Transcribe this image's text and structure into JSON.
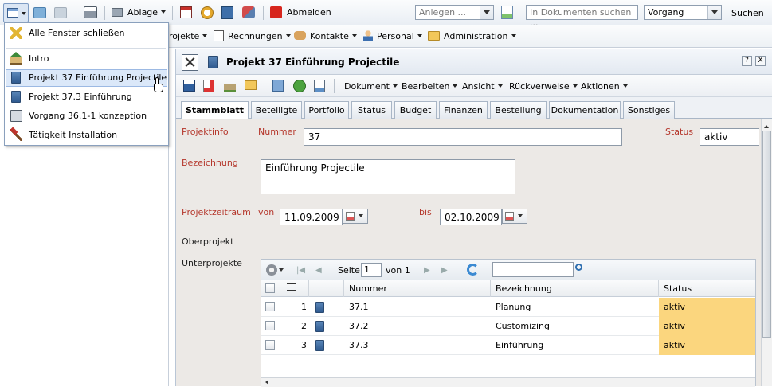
{
  "topbar": {
    "ablage_label": "Ablage",
    "abmelden_label": "Abmelden",
    "anlegen_placeholder": "Anlegen ...",
    "search_placeholder": "In Dokumenten suchen ...",
    "search_scope_value": "Vorgang",
    "suchen_label": "Suchen"
  },
  "menubar": {
    "items": [
      "rojekte",
      "Rechnungen",
      "Kontakte",
      "Personal",
      "Administration"
    ]
  },
  "window_menu": {
    "items": [
      {
        "label": "Alle Fenster schließen",
        "icon": "close-all-icon"
      },
      {
        "label": "Intro",
        "icon": "home-icon"
      },
      {
        "label": "Projekt 37 Einführung Projectile",
        "icon": "project-book-icon"
      },
      {
        "label": "Projekt 37.3 Einführung",
        "icon": "project-book-icon"
      },
      {
        "label": "Vorgang 36.1-1 konzeption",
        "icon": "process-icon"
      },
      {
        "label": "Tätigkeit Installation",
        "icon": "hammer-icon"
      }
    ]
  },
  "panel": {
    "title": "Projekt 37 Einführung Projectile",
    "help": "?",
    "close": "X",
    "toolbar_menus": [
      "Dokument",
      "Bearbeiten",
      "Ansicht",
      "Rückverweise",
      "Aktionen"
    ],
    "tabs": [
      "Stammblatt",
      "Beteiligte",
      "Portfolio",
      "Status",
      "Budget",
      "Finanzen",
      "Bestellung",
      "Dokumentation",
      "Sonstiges"
    ]
  },
  "form": {
    "projektinfo_label": "Projektinfo",
    "nummer_label": "Nummer",
    "nummer_value": "37",
    "status_label": "Status",
    "status_value": "aktiv",
    "bezeichnung_label": "Bezeichnung",
    "bezeichnung_value": "Einführung Projectile",
    "zeitraum_label": "Projektzeitraum",
    "von_label": "von",
    "von_value": "11.09.2009",
    "bis_label": "bis",
    "bis_value": "02.10.2009",
    "oberprojekt_label": "Oberprojekt",
    "unterprojekte_label": "Unterprojekte"
  },
  "grid": {
    "seite_label": "Seite",
    "page_value": "1",
    "von_label": "von 1",
    "columns": [
      "Nummer",
      "Bezeichnung",
      "Status"
    ],
    "rows": [
      {
        "idx": "1",
        "nummer": "37.1",
        "bezeichnung": "Planung",
        "status": "aktiv"
      },
      {
        "idx": "2",
        "nummer": "37.2",
        "bezeichnung": "Customizing",
        "status": "aktiv"
      },
      {
        "idx": "3",
        "nummer": "37.3",
        "bezeichnung": "Einführung",
        "status": "aktiv"
      }
    ]
  },
  "colors": {
    "label_red": "#b5372c",
    "status_highlight": "#fbd67e",
    "menu_highlight": "#dbe8f9"
  }
}
